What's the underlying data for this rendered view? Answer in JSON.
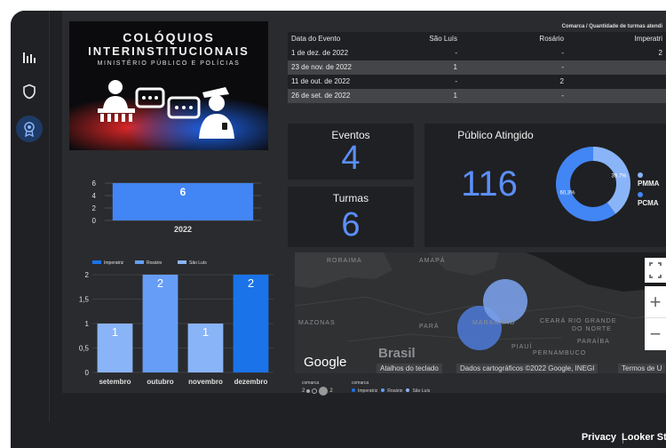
{
  "banner": {
    "title_line1": "COLÓQUIOS",
    "title_line2": "INTERINSTITUCIONAIS",
    "subtitle": "MINISTÉRIO PÚBLICO E POLÍCIAS"
  },
  "rail": {
    "expand_label": "›"
  },
  "table": {
    "top_label": "Comarca / Quantidade de turmas atendi",
    "headers": [
      "Data do Evento",
      "São Luís",
      "Rosário",
      "Imperatri"
    ],
    "rows": [
      [
        "1 de dez. de 2022",
        "-",
        "-",
        "2"
      ],
      [
        "23 de nov. de 2022",
        "1",
        "-",
        ""
      ],
      [
        "11 de out. de 2022",
        "-",
        "2",
        ""
      ],
      [
        "26 de set. de 2022",
        "1",
        "-",
        ""
      ]
    ]
  },
  "kpi": {
    "eventos_label": "Eventos",
    "eventos_value": "4",
    "turmas_label": "Turmas",
    "turmas_value": "6",
    "publico_label": "Público Atingido",
    "publico_value": "116"
  },
  "donut": {
    "segments": [
      {
        "label": "PMMA",
        "pct": 39.7,
        "pct_text": "39,7%",
        "color": "#8ab4f8"
      },
      {
        "label": "PCMA",
        "pct": 60.3,
        "pct_text": "60,3%",
        "color": "#4285f4"
      }
    ]
  },
  "chart_data": [
    {
      "type": "bar",
      "categories": [
        "2022"
      ],
      "values": [
        6
      ],
      "ylim": [
        0,
        6
      ],
      "yticks": [
        "0",
        "2",
        "4",
        "6"
      ],
      "color": "#4285f4"
    },
    {
      "type": "bar",
      "categories": [
        "setembro",
        "outubro",
        "novembro",
        "dezembro"
      ],
      "values": [
        1,
        2,
        1,
        2
      ],
      "value_labels": [
        "1",
        "2",
        "1",
        "2"
      ],
      "colors": [
        "#8ab4f8",
        "#669df6",
        "#8ab4f8",
        "#1a73e8"
      ],
      "ylim": [
        0,
        2
      ],
      "yticks": [
        "0",
        "0,5",
        "1",
        "1,5",
        "2"
      ],
      "legend": [
        {
          "name": "Imperatriz",
          "color": "#1a73e8"
        },
        {
          "name": "Rosário",
          "color": "#669df6"
        },
        {
          "name": "São Luís",
          "color": "#8ab4f8"
        }
      ]
    }
  ],
  "map": {
    "labels": [
      "RORAIMA",
      "AMAPÁ",
      "MAZONAS",
      "PARÁ",
      "MARANHÃO",
      "CEARÁ RIO GRANDE",
      "DO NORTE",
      "PARAÍBA",
      "PIAUÍ",
      "PERNAMBUCO",
      "Brasil"
    ],
    "google": "Google",
    "shortcuts": "Atalhos do teclado",
    "mapdata": "Dados cartográficos ©2022 Google, INEGI",
    "terms": "Termos de U",
    "legend_size_title": "comarca",
    "legend_size_items": [
      "2",
      "2"
    ],
    "legend_color_title": "comarca",
    "legend_color_items": [
      {
        "name": "Imperatriz",
        "color": "#1a73e8"
      },
      {
        "name": "Rosário",
        "color": "#669df6"
      },
      {
        "name": "São Luís",
        "color": "#8ab4f8"
      }
    ],
    "zoom_in": "+",
    "zoom_out": "−"
  },
  "footer": {
    "privacy": "Privacy",
    "brand": "Looker Studio"
  }
}
